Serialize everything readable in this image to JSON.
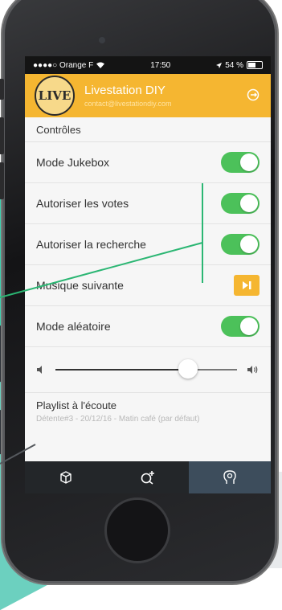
{
  "status_bar": {
    "carrier": "●●●●○ Orange F",
    "time": "17:50",
    "battery": "54 %"
  },
  "header": {
    "logo_text": "LIVE",
    "title": "Livestation DIY",
    "email": "contact@livestationdiy.com"
  },
  "controls": {
    "section_title": "Contrôles",
    "items": [
      {
        "label": "Mode Jukebox",
        "toggle_on": true
      },
      {
        "label": "Autoriser les votes",
        "toggle_on": true
      },
      {
        "label": "Autoriser la recherche",
        "toggle_on": true
      },
      {
        "label": "Musique suivante"
      },
      {
        "label": "Mode aléatoire",
        "toggle_on": true
      }
    ]
  },
  "volume": {
    "level": 0.73
  },
  "playlist": {
    "title": "Playlist à l'écoute",
    "subtitle": "Détente#3 - 20/12/16 - Matin café (par défaut)"
  },
  "tabs": [
    {
      "icon": "cube-icon",
      "active": false
    },
    {
      "icon": "add-search-icon",
      "active": false
    },
    {
      "icon": "head-icon",
      "active": true
    }
  ],
  "colors": {
    "accent": "#f5b631",
    "toggle_on": "#4cc15a",
    "tabbar": "#232629",
    "tab_active": "#3d4d5c"
  }
}
